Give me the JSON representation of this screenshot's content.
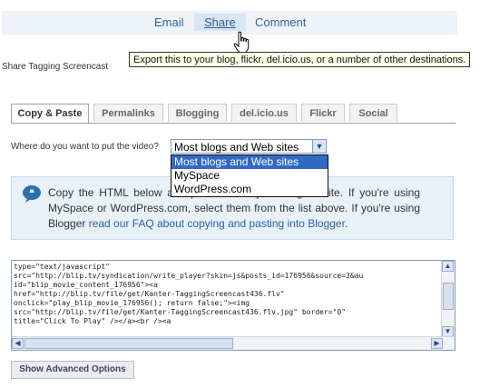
{
  "nav": {
    "email": "Email",
    "share": "Share",
    "comment": "Comment"
  },
  "tooltip": "Export this to your blog, flickr, del.icio.us, or a number of other destinations.",
  "page_title": "Share Tagging Screencast",
  "tabs": [
    "Copy & Paste",
    "Permalinks",
    "Blogging",
    "del.icio.us",
    "Flickr",
    "Social"
  ],
  "question": "Where do you want to put the video?",
  "select": {
    "value": "Most blogs and Web sites",
    "options": [
      "Most blogs and Web sites",
      "MySpace",
      "WordPress.com"
    ]
  },
  "info": {
    "text": "Copy the HTML below and paste it into your blog or site. If you're using MySpace or WordPress.com, select them from the list above. If you're using Blogger ",
    "link": "read our FAQ about copying and pasting into Blogger",
    "tail": "."
  },
  "code": "type=\"text/javascript\"\nsrc=\"http://blip.tv/syndication/write_player?skin=js&posts_id=176956&source=3&au\nid=\"blip_movie_content_176956\"><a\nhref=\"http://blip.tv/file/get/Kanter-TaggingScreencast436.flv\"\nonclick=\"play_blip_movie_176956(); return false;\"><img\nsrc=\"http://blip.tv/file/get/Kanter-TaggingScreencast436.flv.jpg\" border=\"0\"\ntitle=\"Click To Play\" /></a><br /><a",
  "advanced_button": "Show Advanced Options"
}
